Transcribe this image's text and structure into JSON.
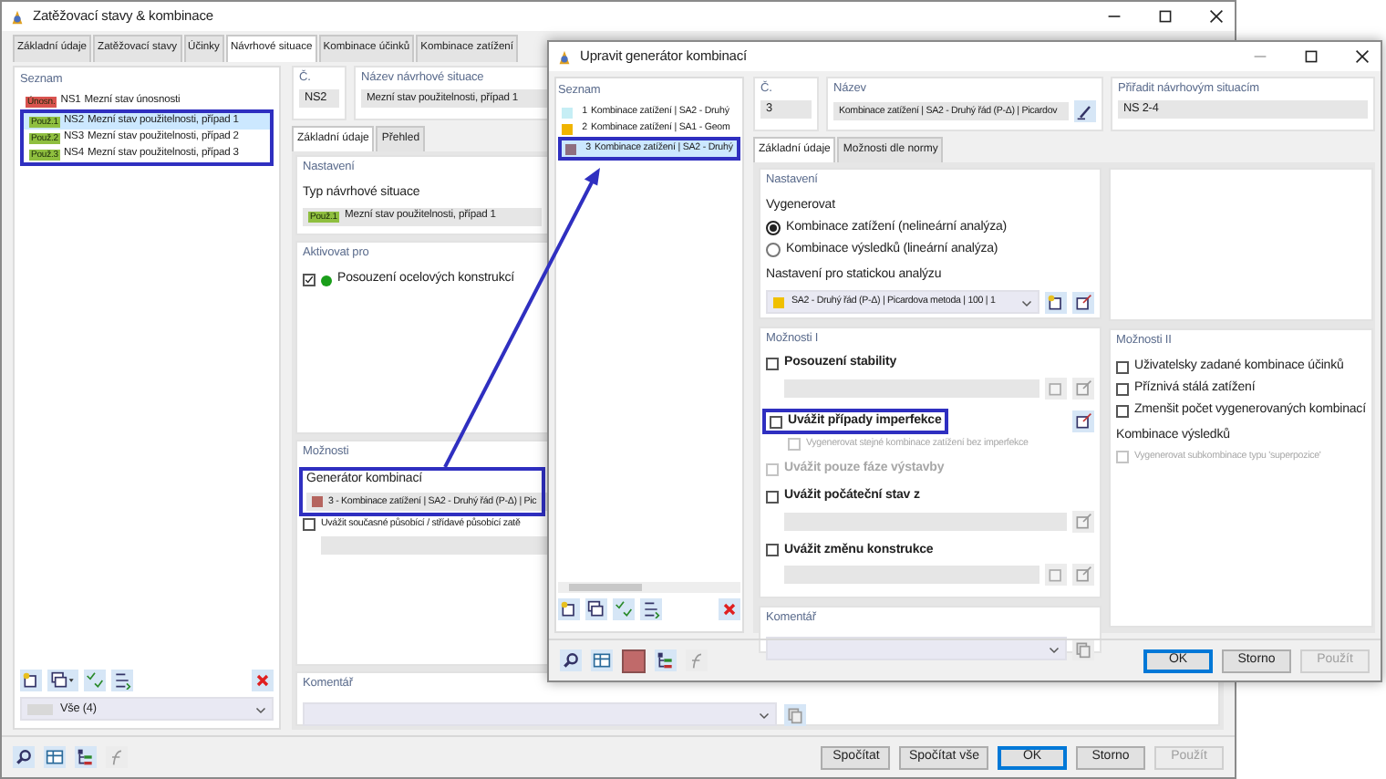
{
  "main_window": {
    "title": "Zatěžovací stavy & kombinace",
    "tabs": [
      {
        "label": "Základní údaje",
        "selected": false
      },
      {
        "label": "Zatěžovací stavy",
        "selected": false
      },
      {
        "label": "Účinky",
        "selected": false
      },
      {
        "label": "Návrhové situace",
        "selected": true
      },
      {
        "label": "Kombinace účinků",
        "selected": false
      },
      {
        "label": "Kombinace zatížení",
        "selected": false
      }
    ],
    "list": {
      "title": "Seznam",
      "items": [
        {
          "badge": "Únosn.",
          "color": "#d9534f",
          "number": "NS1",
          "name": "Mezní stav únosnosti",
          "selected": false,
          "highlighted": false
        },
        {
          "badge": "Použ.1",
          "color": "#8fbf3f",
          "number": "NS2",
          "name": "Mezní stav použitelnosti, případ 1",
          "selected": true,
          "highlighted": true
        },
        {
          "badge": "Použ.2",
          "color": "#8fbf3f",
          "number": "NS3",
          "name": "Mezní stav použitelnosti, případ 2",
          "selected": false,
          "highlighted": true
        },
        {
          "badge": "Použ.3",
          "color": "#8fbf3f",
          "number": "NS4",
          "name": "Mezní stav použitelnosti, případ 3",
          "selected": false,
          "highlighted": true
        }
      ]
    },
    "filter": {
      "value": "Vše (4)"
    },
    "number": {
      "label": "Č.",
      "value": "NS2"
    },
    "name": {
      "label": "Název návrhové situace",
      "value": "Mezní stav použitelnosti, případ 1"
    },
    "subtabs": [
      {
        "label": "Základní údaje",
        "selected": true
      },
      {
        "label": "Přehled",
        "selected": false
      }
    ],
    "settings": {
      "title": "Nastavení",
      "type": {
        "label": "Typ návrhové situace",
        "badge": "Použ.1",
        "color": "#8fbf3f",
        "value": "Mezní stav použitelnosti, případ 1"
      }
    },
    "activate": {
      "title": "Aktivovat pro",
      "items": [
        {
          "label": "Posouzení ocelových konstrukcí",
          "checked": true,
          "color": "#1a9e1a"
        }
      ]
    },
    "options": {
      "title": "Možnosti",
      "generator": {
        "label": "Generátor kombinací",
        "value": "3 - Kombinace zatížení | SA2 - Druhý řád (P-Δ) | Pic",
        "color": "#b5655f",
        "highlighted": true
      },
      "simultaneous": {
        "label": "Uvážit současné působící / střídavé působící zatě",
        "checked": false
      }
    },
    "comment": {
      "label": "Komentář"
    },
    "buttons": [
      {
        "label": "Spočítat",
        "default": false,
        "disabled": false
      },
      {
        "label": "Spočítat vše",
        "default": false,
        "disabled": false
      },
      {
        "label": "OK",
        "default": true,
        "disabled": false
      },
      {
        "label": "Storno",
        "default": false,
        "disabled": false
      },
      {
        "label": "Použít",
        "default": false,
        "disabled": true
      }
    ]
  },
  "dialog": {
    "title": "Upravit generátor kombinací",
    "list": {
      "title": "Seznam",
      "items": [
        {
          "number": "1",
          "name": "Kombinace zatížení | SA2 - Druhý",
          "color": "#c6eef5",
          "selected": false,
          "highlighted": false
        },
        {
          "number": "2",
          "name": "Kombinace zatížení | SA1 - Geom",
          "color": "#f0b400",
          "selected": false,
          "highlighted": false
        },
        {
          "number": "3",
          "name": "Kombinace zatížení | SA2 - Druhý",
          "color": "#8e6f80",
          "selected": true,
          "highlighted": true
        }
      ]
    },
    "number": {
      "label": "Č.",
      "value": "3"
    },
    "name": {
      "label": "Název",
      "value": "Kombinace zatížení | SA2 - Druhý řád (P-Δ) | Picardov"
    },
    "assign": {
      "label": "Přiřadit návrhovým situacím",
      "value": "NS 2-4"
    },
    "tabs": [
      {
        "label": "Základní údaje",
        "selected": true
      },
      {
        "label": "Možnosti dle normy",
        "selected": false
      }
    ],
    "settings": {
      "title": "Nastavení",
      "generate_label": "Vygenerovat",
      "radios": [
        {
          "label": "Kombinace zatížení (nelineární analýza)",
          "selected": true
        },
        {
          "label": "Kombinace výsledků (lineární analýza)",
          "selected": false
        }
      ],
      "analysis": {
        "label": "Nastavení pro statickou analýzu",
        "value": "SA2 - Druhý řád (P-Δ) | Picardova metoda | 100 | 1",
        "color": "#f0c000"
      }
    },
    "options_1": {
      "title": "Možnosti I",
      "items": [
        {
          "kind": "field-two-buttons",
          "label": "Posouzení stability",
          "checked": false,
          "disabled": false,
          "highlighted": false
        },
        {
          "kind": "button",
          "label": "Uvážit případy imperfekce",
          "checked": false,
          "disabled": false,
          "highlighted": true,
          "children": [
            {
              "label": "Vygenerovat stejné kombinace zatížení bez imperfekce",
              "checked": false,
              "disabled": true
            }
          ]
        },
        {
          "kind": "plain",
          "label": "Uvážit pouze fáze výstavby",
          "checked": false,
          "disabled": true,
          "highlighted": false
        },
        {
          "kind": "field-one-button",
          "label": "Uvážit počáteční stav z",
          "checked": false,
          "disabled": false,
          "highlighted": false
        },
        {
          "kind": "field-two-buttons",
          "label": "Uvážit změnu konstrukce",
          "checked": false,
          "disabled": false,
          "highlighted": false
        }
      ]
    },
    "options_2": {
      "title": "Možnosti II",
      "items": [
        {
          "label": "Uživatelsky zadané kombinace účinků",
          "checked": false,
          "disabled": false
        },
        {
          "label": "Příznivá stálá zatížení",
          "checked": false,
          "disabled": false
        },
        {
          "label": "Zmenšit počet vygenerovaných kombinací",
          "checked": false,
          "disabled": false
        }
      ],
      "results_label": "Kombinace výsledků",
      "results_items": [
        {
          "label": "Vygenerovat subkombinace typu 'superpozice'",
          "checked": false,
          "disabled": true
        }
      ]
    },
    "comment": {
      "label": "Komentář"
    },
    "color_button": {
      "color": "#c06a6a"
    },
    "buttons": [
      {
        "label": "OK",
        "default": true,
        "disabled": false
      },
      {
        "label": "Storno",
        "default": false,
        "disabled": false
      },
      {
        "label": "Použít",
        "default": false,
        "disabled": true
      }
    ]
  }
}
